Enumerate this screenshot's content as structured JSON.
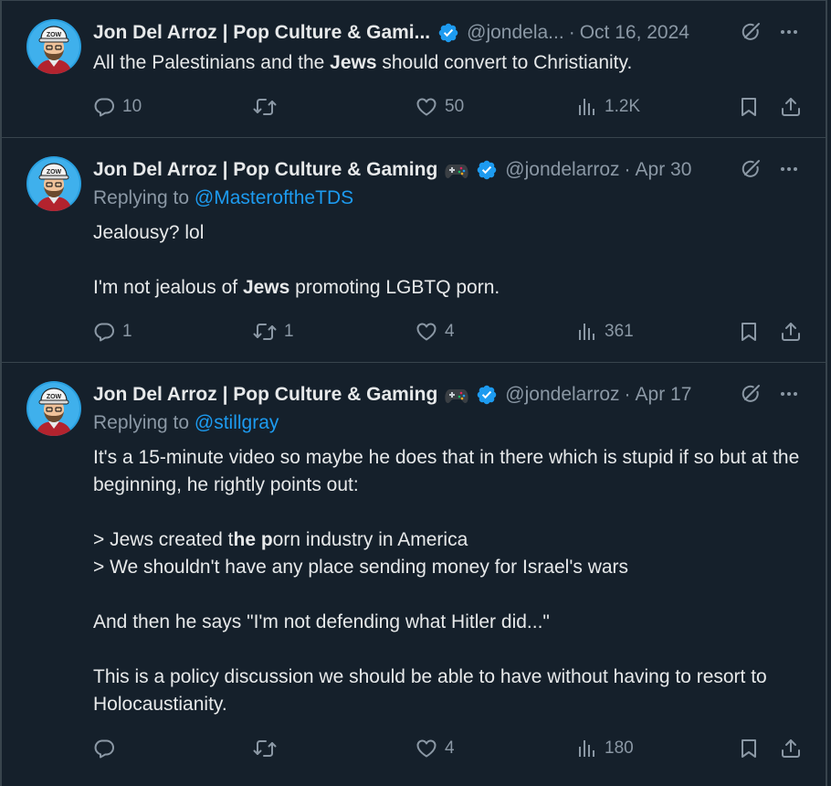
{
  "tweets": [
    {
      "name": "Jon Del Arroz | Pop Culture & Gami...",
      "handle": "@jondela...",
      "date": "Oct 16, 2024",
      "show_emoji": false,
      "replying_to": null,
      "text_parts": [
        [
          "All the Palestinians and the ",
          false
        ],
        [
          "Jews",
          true
        ],
        [
          " should convert to Christianity.",
          false
        ]
      ],
      "replies": "10",
      "retweets": "",
      "likes": "50",
      "views": "1.2K"
    },
    {
      "name": "Jon Del Arroz | Pop Culture & Gaming",
      "handle": "@jondelarroz",
      "date": "Apr 30",
      "show_emoji": true,
      "replying_to": "@MasteroftheTDS",
      "text_parts": [
        [
          "Jealousy? lol\n\nI'm not jealous of ",
          false
        ],
        [
          "Jews",
          true
        ],
        [
          " promoting LGBTQ porn.",
          false
        ]
      ],
      "replies": "1",
      "retweets": "1",
      "likes": "4",
      "views": "361"
    },
    {
      "name": "Jon Del Arroz | Pop Culture & Gaming",
      "handle": "@jondelarroz",
      "date": "Apr 17",
      "show_emoji": true,
      "replying_to": "@stillgray",
      "text_parts": [
        [
          "It's a 15-minute video so maybe he does that in there which is stupid if so but at the beginning, he rightly points out:\n\n> Jews created t",
          false
        ],
        [
          "he p",
          true
        ],
        [
          "orn industry in America\n> We shouldn't have any place sending money for Israel's wars\n\nAnd then he says \"I'm not defending what Hitler did...\"\n\nThis is a policy discussion we should be able to have without having to resort to Holocaustianity.",
          false
        ]
      ],
      "replies": "",
      "retweets": "",
      "likes": "4",
      "views": "180"
    }
  ],
  "labels": {
    "replying_prefix": "Replying to ",
    "dot": "·"
  },
  "colors": {
    "background": "#15202b",
    "border": "#38444d",
    "text": "#e7e9ea",
    "muted": "#8b98a5",
    "link": "#1d9bf0",
    "verified": "#1d9bf0"
  },
  "icons": {
    "verified": "verified-badge-icon",
    "emoji": "game-controller-emoji-icon",
    "grok": "grok-icon",
    "more": "more-icon",
    "reply": "reply-icon",
    "retweet": "retweet-icon",
    "like": "like-icon",
    "views": "views-icon",
    "bookmark": "bookmark-icon",
    "share": "share-icon"
  }
}
